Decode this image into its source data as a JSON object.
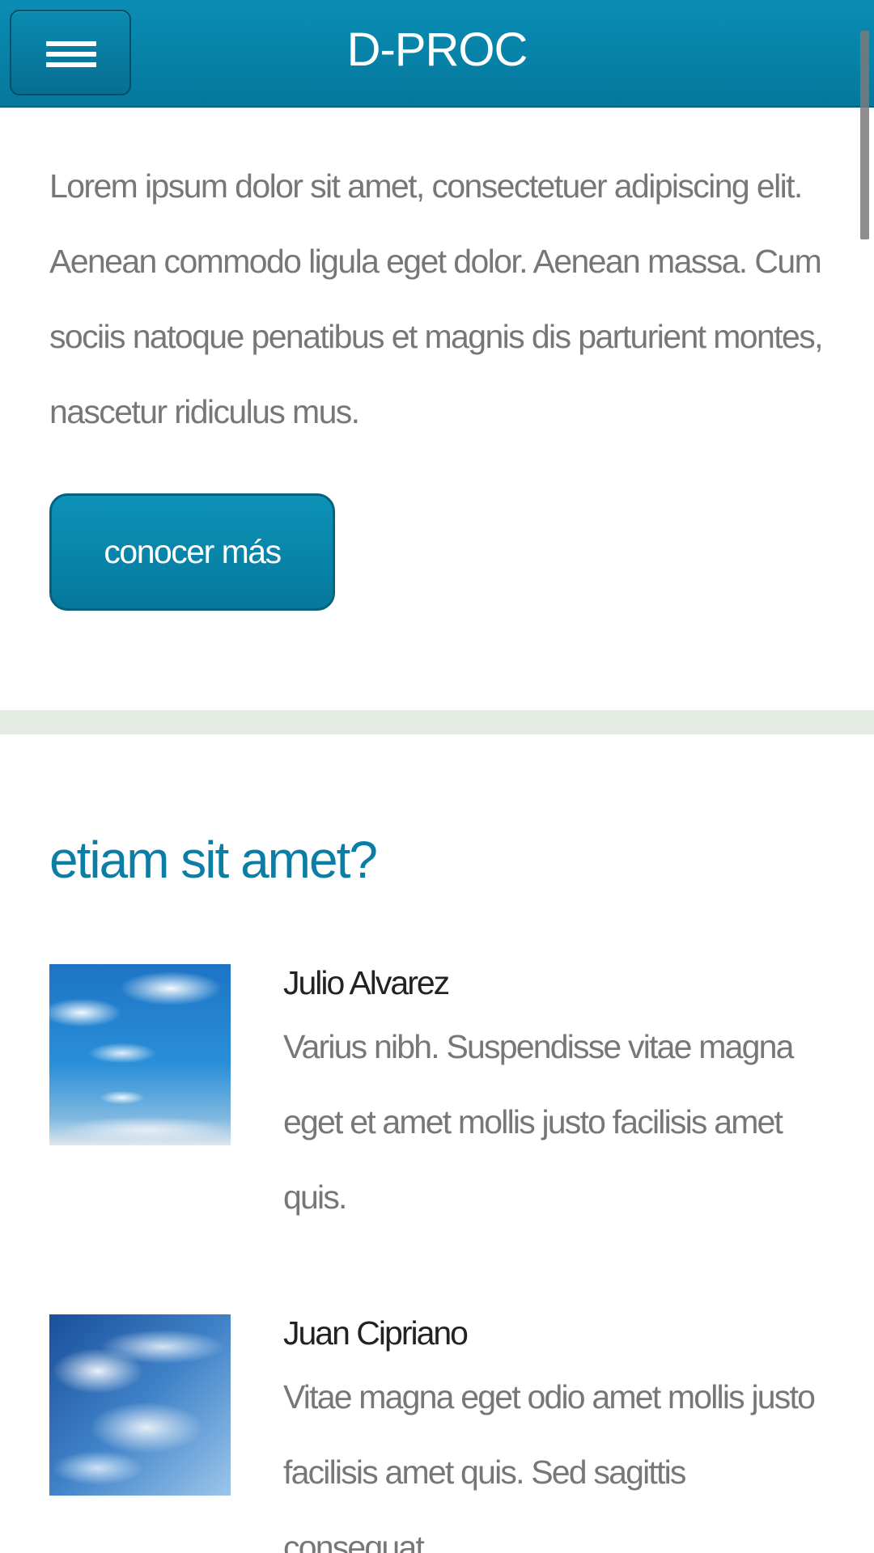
{
  "header": {
    "title": "D-PROC",
    "menu_icon": "hamburger-menu-icon",
    "background_color": "#0a84ac"
  },
  "intro": {
    "text": "Lorem ipsum dolor sit amet, consectetuer adipiscing elit. Aenean commodo ligula eget dolor. Aenean massa. Cum sociis natoque penatibus et magnis dis parturient montes, nascetur ridiculus mus.",
    "button_label": "conocer más"
  },
  "section": {
    "title": "etiam sit amet?",
    "title_color": "#0b7ea5",
    "entries": [
      {
        "name": "Julio Alvarez",
        "text": "Varius nibh. Suspendisse vitae magna eget et amet mollis justo facilisis amet quis.",
        "image": "sky-with-clouds-photo"
      },
      {
        "name": "Juan Cipriano",
        "text": "Vitae magna eget odio amet mollis justo facilisis amet quis. Sed sagittis consequat.",
        "image": "sky-with-clouds-photo"
      }
    ]
  }
}
